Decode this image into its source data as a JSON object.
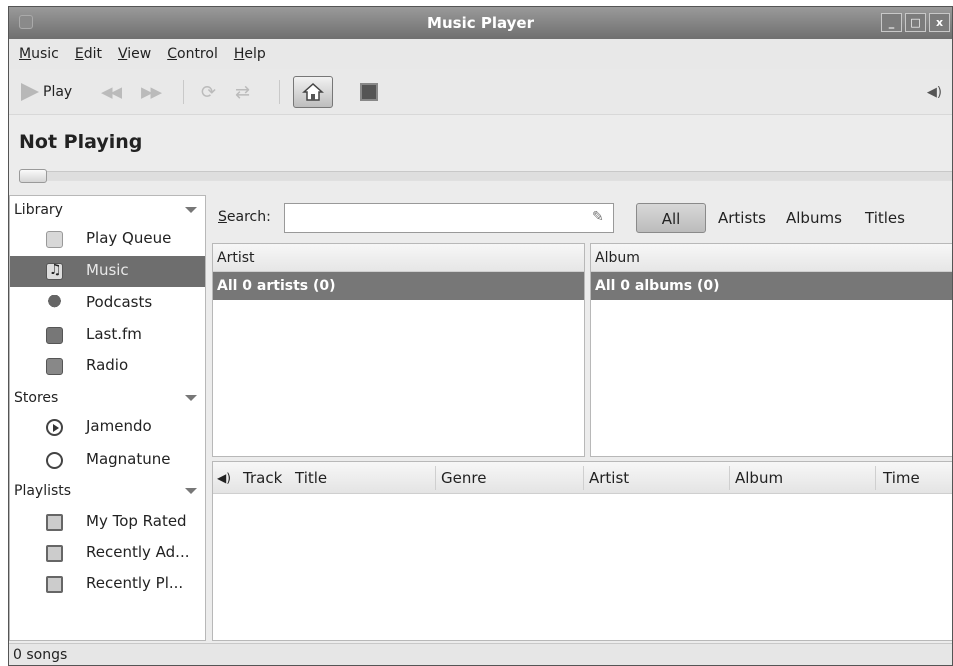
{
  "window": {
    "title": "Music Player",
    "buttons": {
      "minimize": "_",
      "maximize": "□",
      "close": "x"
    }
  },
  "menubar": [
    "Music",
    "Edit",
    "View",
    "Control",
    "Help"
  ],
  "toolbar": {
    "play_label": "Play",
    "volume_icon": "speaker-icon"
  },
  "status": {
    "now_playing": "Not Playing",
    "progress": 0
  },
  "sidebar": {
    "sections": [
      {
        "label": "Library",
        "items": [
          {
            "label": "Play Queue",
            "icon": "play-queue-icon"
          },
          {
            "label": "Music",
            "icon": "music-note-icon",
            "selected": true
          },
          {
            "label": "Podcasts",
            "icon": "podcast-icon"
          },
          {
            "label": "Last.fm",
            "icon": "lastfm-icon"
          },
          {
            "label": "Radio",
            "icon": "radio-icon"
          }
        ]
      },
      {
        "label": "Stores",
        "items": [
          {
            "label": "Jamendo",
            "icon": "jamendo-icon"
          },
          {
            "label": "Magnatune",
            "icon": "magnatune-icon"
          }
        ]
      },
      {
        "label": "Playlists",
        "items": [
          {
            "label": "My Top Rated",
            "icon": "smart-playlist-icon"
          },
          {
            "label": "Recently Ad...",
            "icon": "smart-playlist-icon"
          },
          {
            "label": "Recently Pl...",
            "icon": "smart-playlist-icon"
          }
        ]
      }
    ]
  },
  "search": {
    "label": "Search:",
    "value": "",
    "filters": [
      "All",
      "Artists",
      "Albums",
      "Titles"
    ],
    "active_filter": "All"
  },
  "browser": {
    "artist_header": "Artist",
    "artist_row": "All 0 artists (0)",
    "album_header": "Album",
    "album_row": "All 0 albums (0)"
  },
  "tracklist": {
    "columns": [
      "Track",
      "Title",
      "Genre",
      "Artist",
      "Album",
      "Time"
    ],
    "rows": []
  },
  "statusbar": {
    "text": "0 songs"
  }
}
